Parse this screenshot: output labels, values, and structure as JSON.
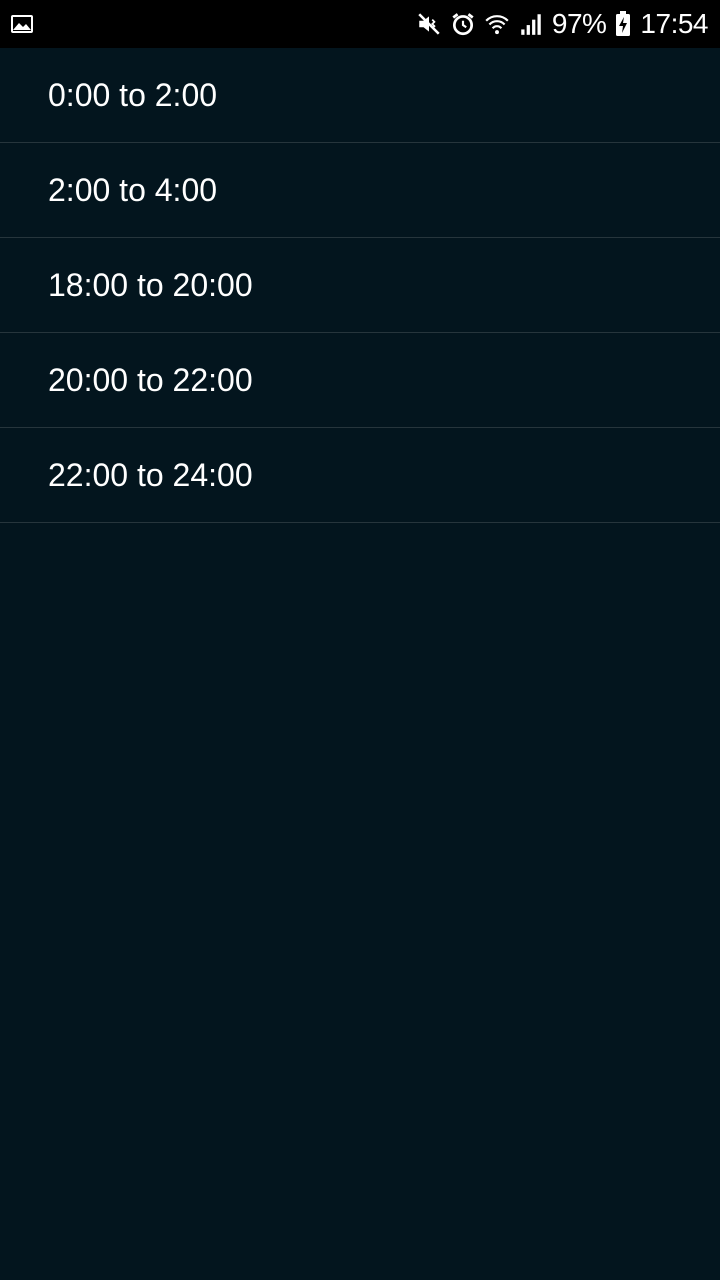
{
  "status_bar": {
    "battery_percent": "97%",
    "time": "17:54",
    "icons": [
      "image-notification-icon",
      "mute-icon",
      "alarm-icon",
      "wifi-icon",
      "signal-icon",
      "battery-charging-icon"
    ]
  },
  "time_slots": [
    {
      "label": "0:00 to 2:00"
    },
    {
      "label": "2:00 to 4:00"
    },
    {
      "label": "18:00 to 20:00"
    },
    {
      "label": "20:00 to 22:00"
    },
    {
      "label": "22:00 to 24:00"
    }
  ],
  "colors": {
    "background": "#03151e",
    "status_bar": "#000000",
    "divider": "#26353c",
    "text": "#ffffff"
  }
}
